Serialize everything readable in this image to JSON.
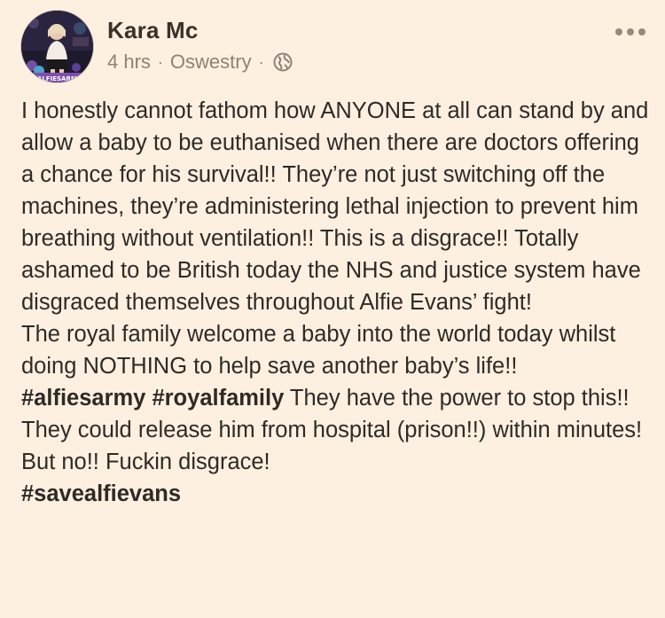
{
  "post": {
    "author": "Kara Mc",
    "time": "4 hrs",
    "separator": "·",
    "location": "Oswestry",
    "privacy_icon": "globe-icon",
    "more_icon": "more-options-icon",
    "avatar_badge": "#ALFIESARMY",
    "paragraphs": [
      "I honestly cannot fathom how ANYONE at all can stand by and allow a baby to be euthanised when there are doctors offering a chance for his survival!! They’re not just switching off the  machines, they’re administering lethal injection to prevent him breathing without ventilation!! This is a disgrace!! Totally ashamed to be British today the NHS and justice system have disgraced themselves throughout Alfie Evans’ fight!",
      "The royal family welcome a baby into the world today whilst doing NOTHING to help save another baby’s life!!"
    ],
    "hashtag_1": "#alfiesarmy",
    "hashtag_2": "#royalfamily",
    "closing_text": " They have the power to stop this!! They could release him from hospital (prison!!) within minutes! But no!! Fuckin disgrace!",
    "hashtag_3": "#savealfievans"
  },
  "colors": {
    "background": "#fdf0e1",
    "text": "#2f2a25",
    "meta": "#8c8277"
  }
}
